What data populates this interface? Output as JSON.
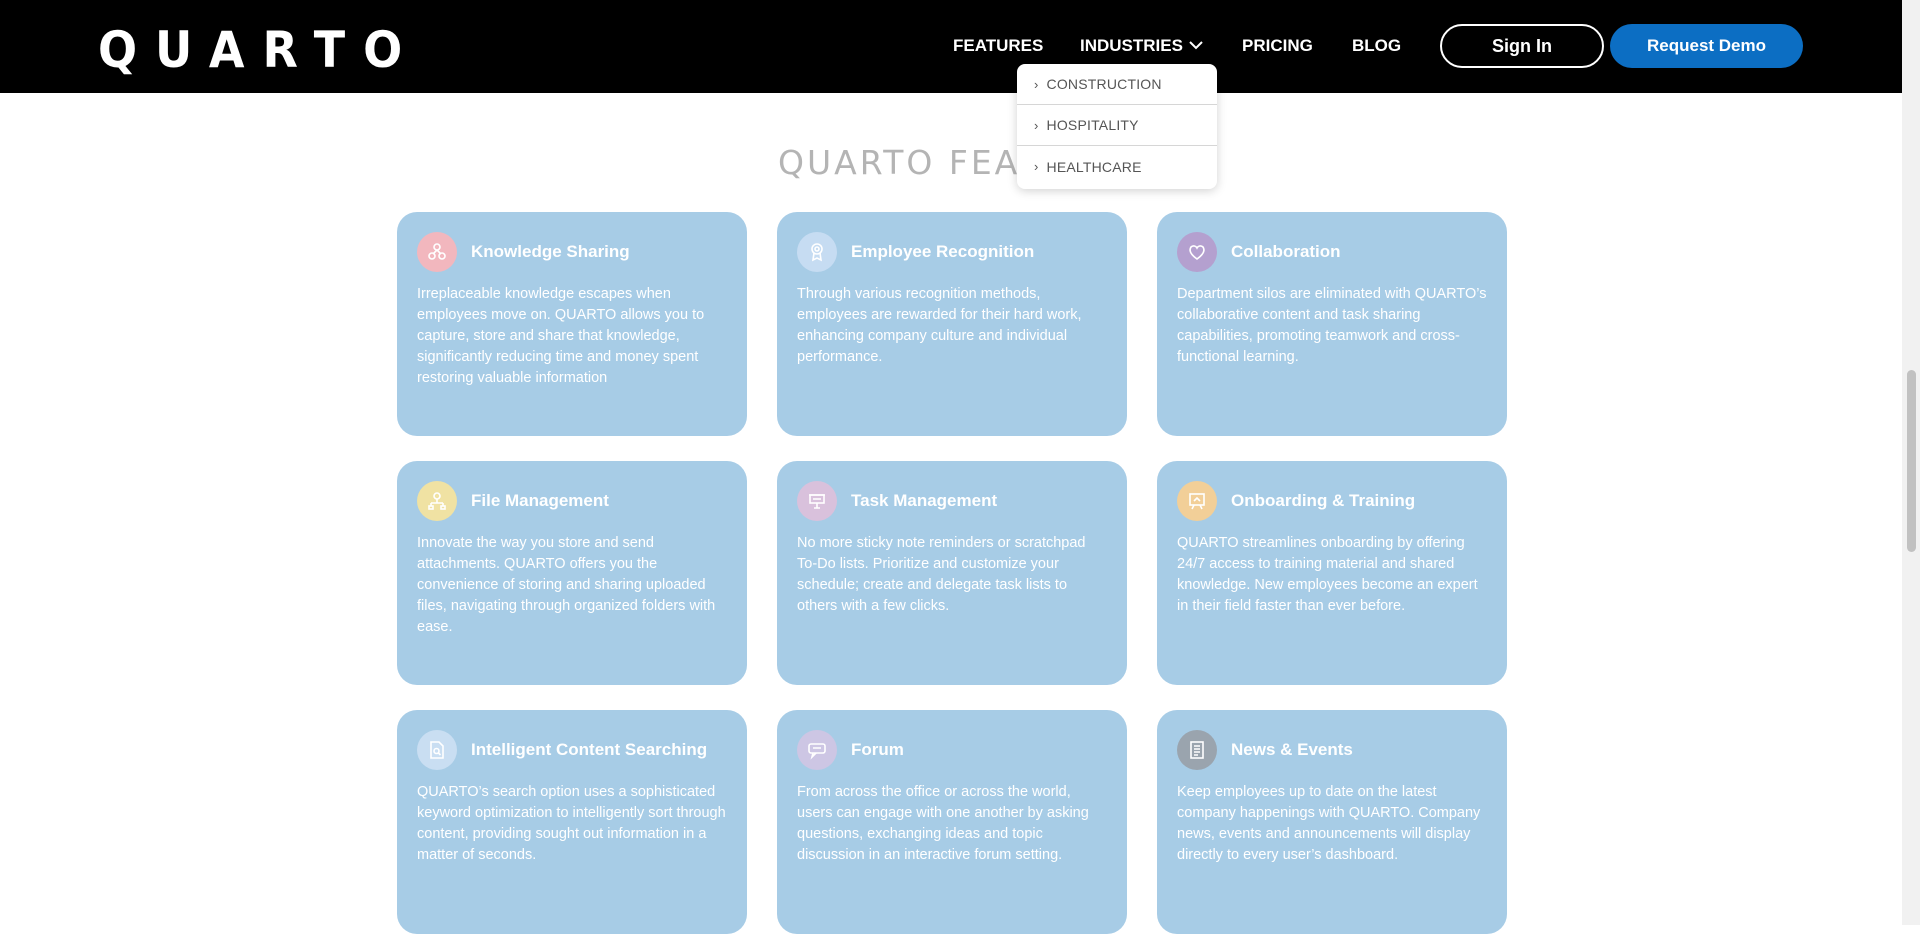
{
  "brand": {
    "logo": "QUARTO"
  },
  "nav": {
    "features": "FEATURES",
    "industries": "INDUSTRIES",
    "pricing": "PRICING",
    "blog": "BLOG",
    "sign_in": "Sign In",
    "request_demo": "Request Demo"
  },
  "industries_menu": [
    "CONSTRUCTION",
    "HOSPITALITY",
    "HEALTHCARE"
  ],
  "section": {
    "title": "QUARTO FEATURES"
  },
  "features": [
    {
      "title": "Knowledge Sharing",
      "text": "Irreplaceable knowledge escapes when employees move on. QUARTO allows you to capture, store and share that knowledge, significantly reducing time and money spent restoring valuable information",
      "icon": "people-share-icon",
      "icon_color": "#f2b7be"
    },
    {
      "title": "Employee Recognition",
      "text": "Through various recognition methods, employees are rewarded for their hard work, enhancing company culture and individual performance.",
      "icon": "award-ribbon-icon",
      "icon_color": "#c6dcf2"
    },
    {
      "title": "Collaboration",
      "text": "Department silos are eliminated with QUARTO’s collaborative content and task sharing capabilities, promoting teamwork and cross-functional learning.",
      "icon": "heart-hands-icon",
      "icon_color": "#b4a0cf"
    },
    {
      "title": "File Management",
      "text": "Innovate the way you store and send attachments. QUARTO offers you the convenience of storing and sharing uploaded files, navigating through organized folders with ease.",
      "icon": "folder-network-icon",
      "icon_color": "#f0e2a3"
    },
    {
      "title": "Task Management",
      "text": "No more sticky note reminders or scratchpad To-Do lists. Prioritize and customize your schedule; create and delegate task lists to others with a few clicks.",
      "icon": "clipboard-icon",
      "icon_color": "#d9c1dc"
    },
    {
      "title": "Onboarding & Training",
      "text": "QUARTO streamlines onboarding by offering 24/7 access to training material and shared knowledge. New employees become an expert in their field faster than ever before.",
      "icon": "presentation-board-icon",
      "icon_color": "#f2cf98"
    },
    {
      "title": "Intelligent Content Searching",
      "text": "QUARTO’s search option uses a sophisticated keyword optimization to intelligently sort through content, providing sought out information in a matter of seconds.",
      "icon": "document-search-icon",
      "icon_color": "#c9def2"
    },
    {
      "title": "Forum",
      "text": "From across the office or across the world, users can engage with one another by asking questions, exchanging ideas and topic discussion in an interactive forum setting.",
      "icon": "speech-bubbles-icon",
      "icon_color": "#cdc6e4"
    },
    {
      "title": "News & Events",
      "text": "Keep employees up to date on the latest company happenings with QUARTO. Company news, events and announcements will display directly to every user’s dashboard.",
      "icon": "newspaper-icon",
      "icon_color": "#9aa4ae"
    }
  ]
}
